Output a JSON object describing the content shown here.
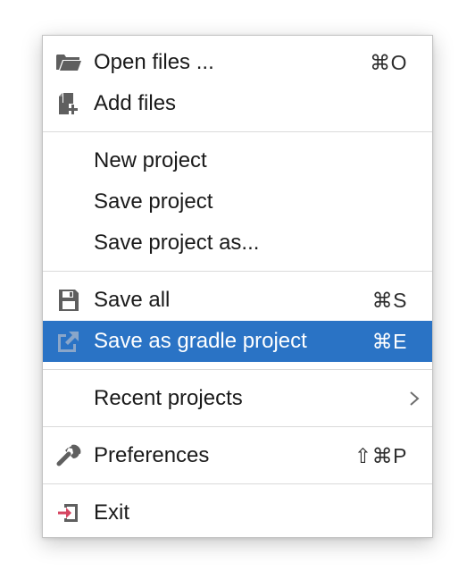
{
  "menu": {
    "items": [
      {
        "label": "Open files ...",
        "shortcut": "⌘O",
        "icon": "folder-open-icon"
      },
      {
        "label": "Add files",
        "shortcut": "",
        "icon": "add-file-icon"
      },
      {
        "label": "New project",
        "shortcut": ""
      },
      {
        "label": "Save project",
        "shortcut": ""
      },
      {
        "label": "Save project as...",
        "shortcut": ""
      },
      {
        "label": "Save all",
        "shortcut": "⌘S",
        "icon": "floppy-disk-icon"
      },
      {
        "label": "Save as gradle project",
        "shortcut": "⌘E",
        "icon": "export-icon",
        "selected": true
      },
      {
        "label": "Recent projects",
        "shortcut": "",
        "submenu": true,
        "icon": "chevron-right-icon"
      },
      {
        "label": "Preferences",
        "shortcut": "⇧⌘P",
        "icon": "wrench-icon"
      },
      {
        "label": "Exit",
        "shortcut": "",
        "icon": "exit-icon"
      }
    ]
  },
  "colors": {
    "selection": "#2a73c5",
    "icon_gray": "#5f5f5f",
    "exit_red": "#d64561",
    "separator": "#dadada"
  }
}
